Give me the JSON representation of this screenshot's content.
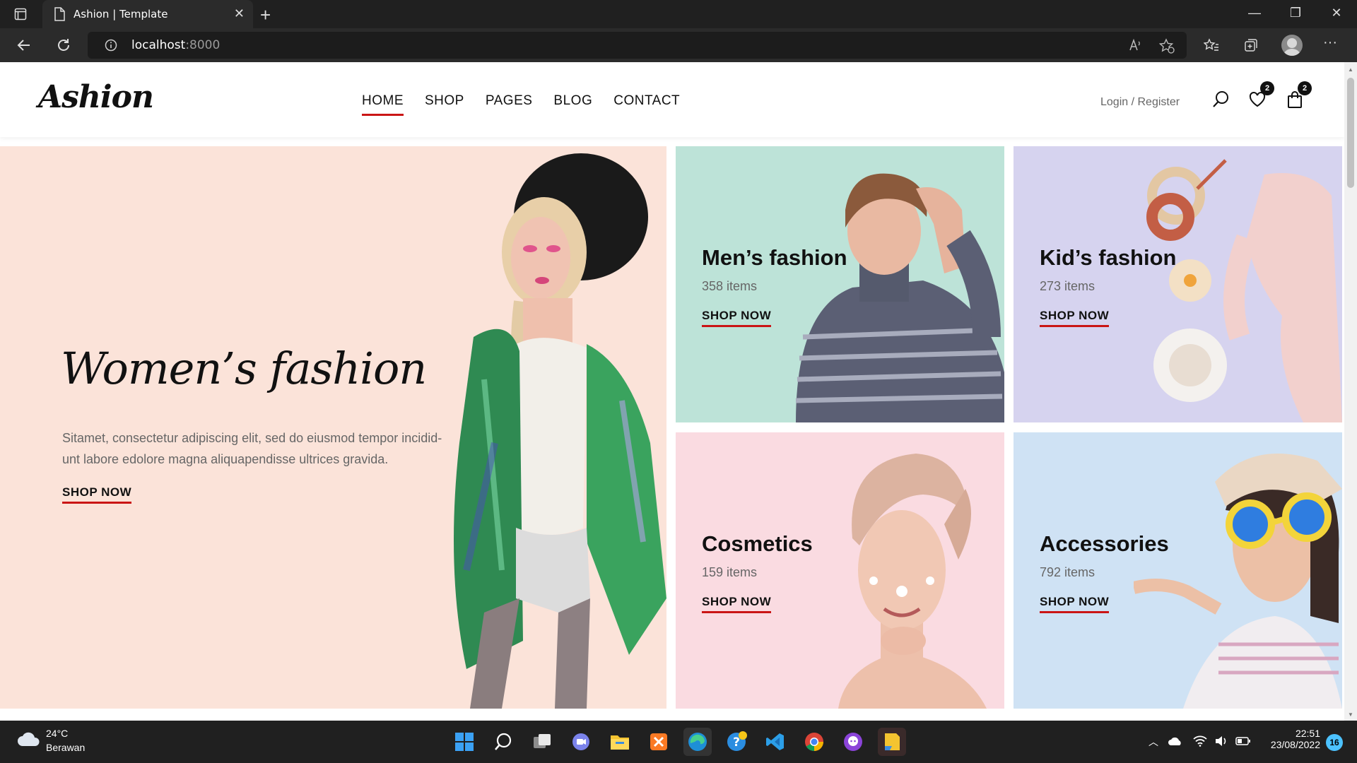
{
  "browser": {
    "tab_title": "Ashion | Template",
    "url_host": "localhost",
    "url_port": ":8000"
  },
  "site": {
    "logo": "Ashion",
    "menu": [
      {
        "label": "HOME",
        "active": true
      },
      {
        "label": "SHOP",
        "active": false
      },
      {
        "label": "PAGES",
        "active": false
      },
      {
        "label": "BLOG",
        "active": false
      },
      {
        "label": "CONTACT",
        "active": false
      }
    ],
    "login_text": "Login / Register",
    "wishlist_count": "2",
    "cart_count": "2"
  },
  "hero": {
    "title": "Women’s fashion",
    "text": "Sitamet, consectetur adipiscing elit, sed do eiusmod tempor incidid-unt labore edolore magna aliquapendisse ultrices gravida.",
    "text_line1": "Sitamet, consectetur adipiscing elit, sed do eiusmod tempor incidid-",
    "text_line2": "unt labore edolore magna aliquapendisse ultrices gravida.",
    "cta": "SHOP NOW",
    "bg": "#fbe3d9"
  },
  "categories": [
    {
      "title": "Men’s fashion",
      "items": "358 items",
      "cta": "SHOP NOW",
      "bg": "#bde3d8"
    },
    {
      "title": "Kid’s fashion",
      "items": "273 items",
      "cta": "SHOP NOW",
      "bg": "#d6d3ef"
    },
    {
      "title": "Cosmetics",
      "items": "159 items",
      "cta": "SHOP NOW",
      "bg": "#fadbe1"
    },
    {
      "title": "Accessories",
      "items": "792 items",
      "cta": "SHOP NOW",
      "bg": "#cfe2f4"
    }
  ],
  "taskbar": {
    "temperature": "24°C",
    "condition": "Berawan",
    "time": "22:51",
    "date": "23/08/2022",
    "notifications": "16"
  },
  "colors": {
    "accent": "#ca1515",
    "chrome_dark": "#202020"
  }
}
